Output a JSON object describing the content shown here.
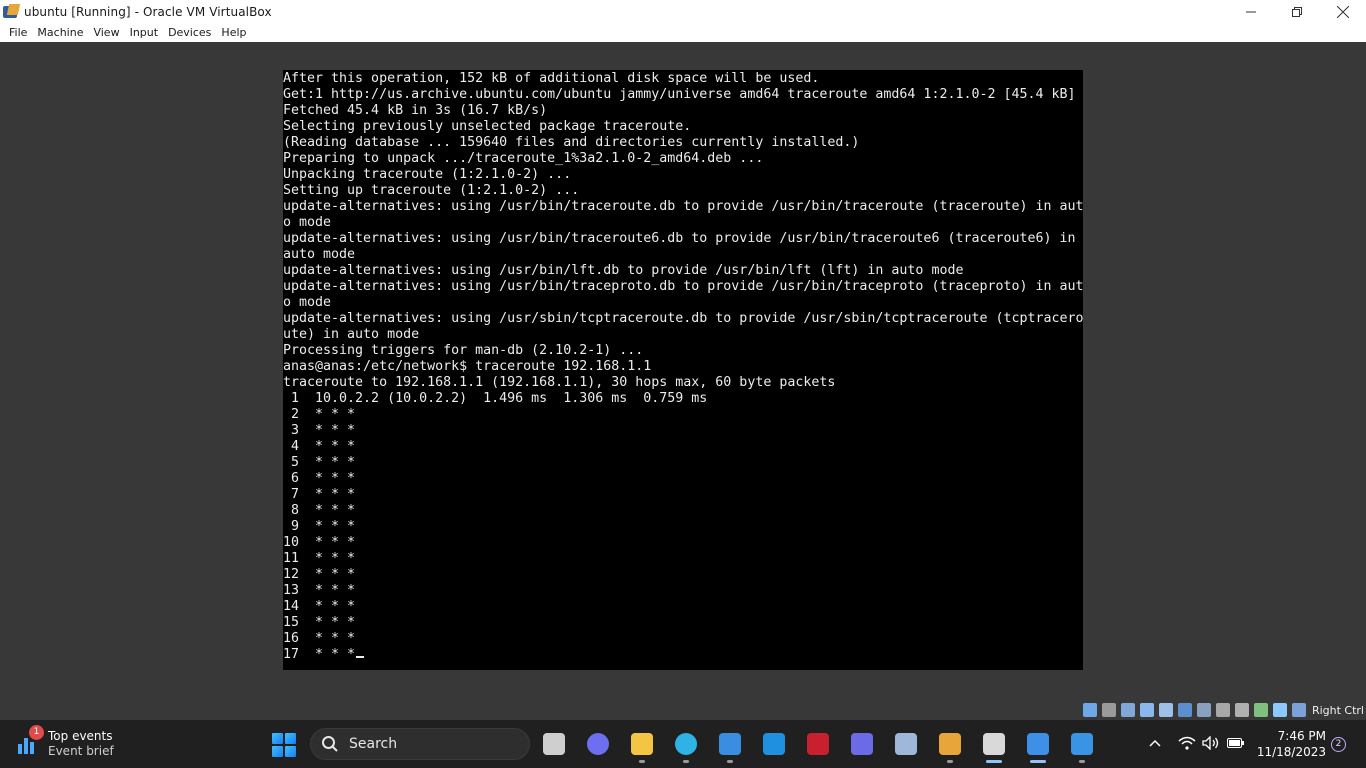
{
  "window": {
    "title": "ubuntu [Running] - Oracle VM VirtualBox",
    "controls": [
      "minimize",
      "restore",
      "close"
    ]
  },
  "menu": [
    "File",
    "Machine",
    "View",
    "Input",
    "Devices",
    "Help"
  ],
  "terminal": {
    "lines": [
      "After this operation, 152 kB of additional disk space will be used.",
      "Get:1 http://us.archive.ubuntu.com/ubuntu jammy/universe amd64 traceroute amd64 1:2.1.0-2 [45.4 kB]",
      "Fetched 45.4 kB in 3s (16.7 kB/s)",
      "Selecting previously unselected package traceroute.",
      "(Reading database ... 159640 files and directories currently installed.)",
      "Preparing to unpack .../traceroute_1%3a2.1.0-2_amd64.deb ...",
      "Unpacking traceroute (1:2.1.0-2) ...",
      "Setting up traceroute (1:2.1.0-2) ...",
      "update-alternatives: using /usr/bin/traceroute.db to provide /usr/bin/traceroute (traceroute) in aut",
      "o mode",
      "update-alternatives: using /usr/bin/traceroute6.db to provide /usr/bin/traceroute6 (traceroute6) in",
      "auto mode",
      "update-alternatives: using /usr/bin/lft.db to provide /usr/bin/lft (lft) in auto mode",
      "update-alternatives: using /usr/bin/traceproto.db to provide /usr/bin/traceproto (traceproto) in aut",
      "o mode",
      "update-alternatives: using /usr/sbin/tcptraceroute.db to provide /usr/sbin/tcptraceroute (tcptracero",
      "ute) in auto mode",
      "Processing triggers for man-db (2.10.2-1) ...",
      "anas@anas:/etc/network$ traceroute 192.168.1.1",
      "traceroute to 192.168.1.1 (192.168.1.1), 30 hops max, 60 byte packets",
      " 1  10.0.2.2 (10.0.2.2)  1.496 ms  1.306 ms  0.759 ms",
      " 2  * * *",
      " 3  * * *",
      " 4  * * *",
      " 5  * * *",
      " 6  * * *",
      " 7  * * *",
      " 8  * * *",
      " 9  * * *",
      "10  * * *",
      "11  * * *",
      "12  * * *",
      "13  * * *",
      "14  * * *",
      "15  * * *",
      "16  * * *",
      "17  * * *"
    ]
  },
  "vbox_status": {
    "icons": [
      "hard-disk-icon",
      "optical-drive-icon",
      "audio-icon",
      "network-icon",
      "usb-icon",
      "shared-folders-icon",
      "display-icon",
      "video-capture-icon",
      "cpu-icon",
      "guest-additions-icon",
      "mouse-integration-icon",
      "keyboard-icon"
    ],
    "host_key_label": "Right Ctrl"
  },
  "taskbar": {
    "widget": {
      "badge": "1",
      "title": "Top events",
      "subtitle": "Event brief"
    },
    "search_label": "Search",
    "apps": [
      {
        "name": "task-view",
        "color": "#cfcfcf"
      },
      {
        "name": "chat",
        "color": "#6e6ef0"
      },
      {
        "name": "file-explorer",
        "color": "#f4c542"
      },
      {
        "name": "edge",
        "color": "#2fb3e6"
      },
      {
        "name": "store",
        "color": "#3a8de0"
      },
      {
        "name": "l-app",
        "color": "#1f8fe0"
      },
      {
        "name": "mcafee",
        "color": "#c8202e"
      },
      {
        "name": "purple-app",
        "color": "#6b6be8"
      },
      {
        "name": "3d-box-app",
        "color": "#9fb7d9"
      },
      {
        "name": "virtualbox",
        "color": "#e8a63a"
      },
      {
        "name": "snipping-tool",
        "color": "#d9d9d9"
      },
      {
        "name": "tool-app",
        "color": "#3d8fe8"
      },
      {
        "name": "photos",
        "color": "#3a94e6"
      }
    ],
    "tray": {
      "time": "7:46 PM",
      "date": "11/18/2023",
      "notifications": "2"
    }
  }
}
